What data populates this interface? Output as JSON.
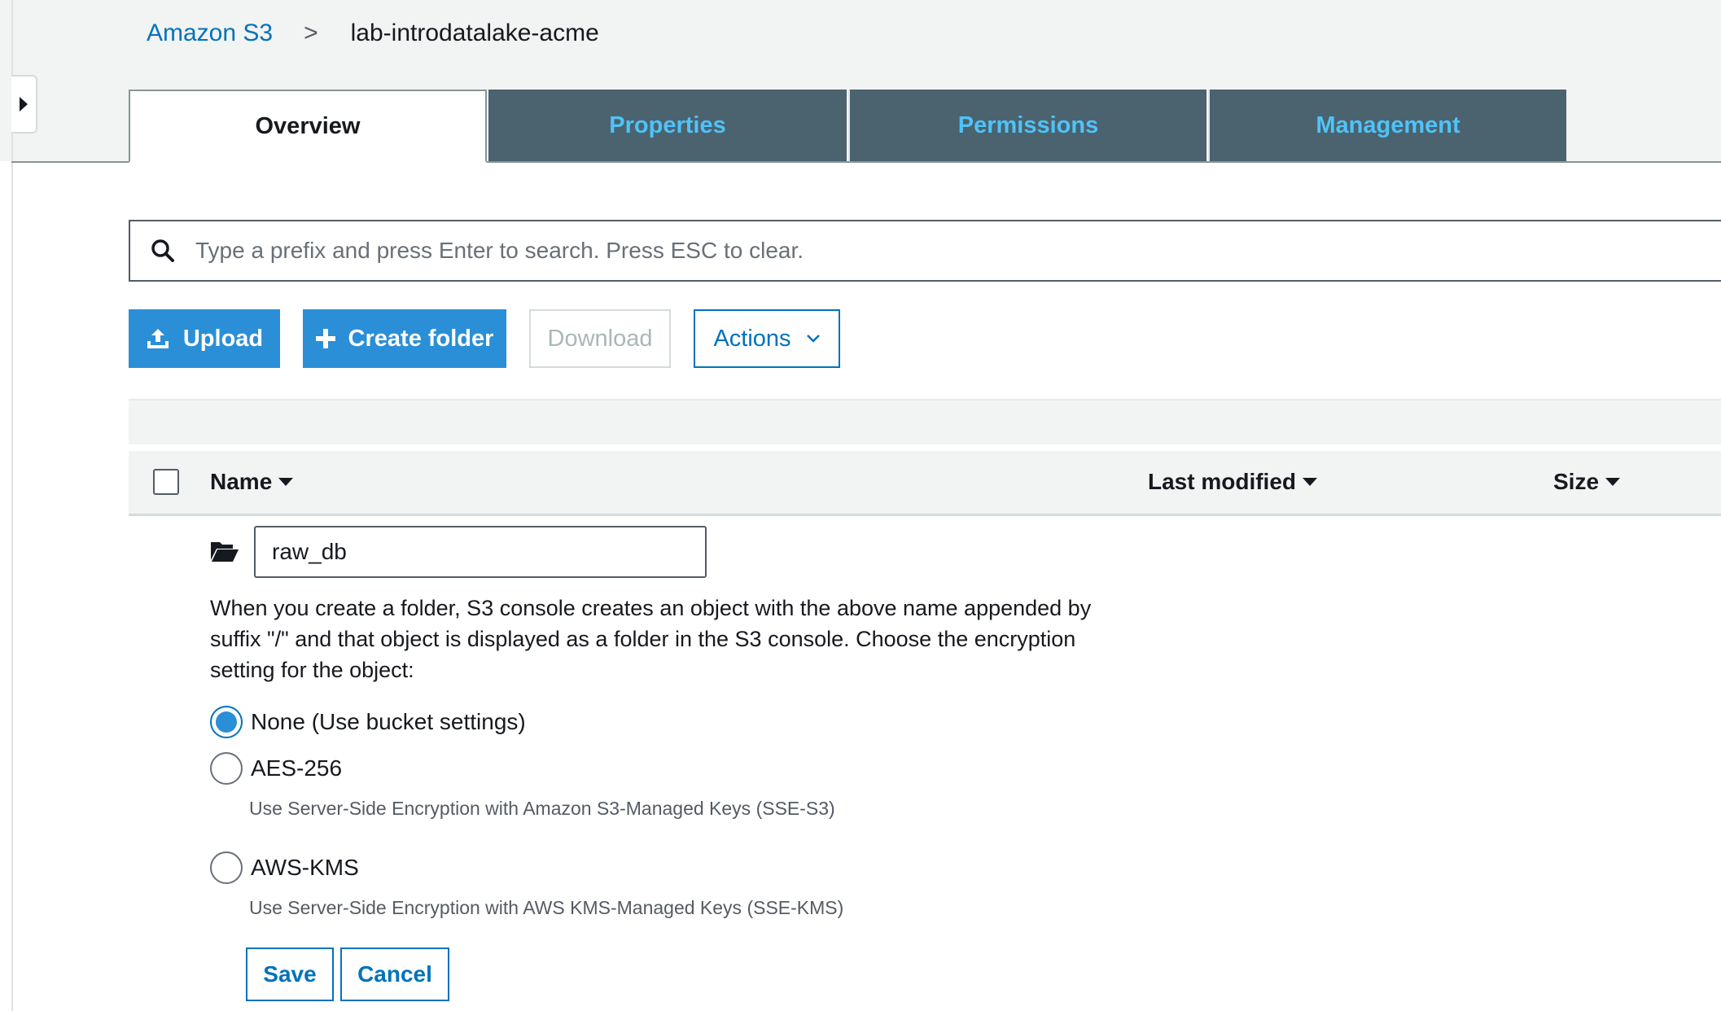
{
  "breadcrumb": {
    "root": "Amazon S3",
    "separator": ">",
    "current": "lab-introdatalake-acme"
  },
  "tabs": [
    {
      "label": "Overview",
      "active": true
    },
    {
      "label": "Properties",
      "active": false
    },
    {
      "label": "Permissions",
      "active": false
    },
    {
      "label": "Management",
      "active": false
    }
  ],
  "search": {
    "icon": "search-icon",
    "placeholder": "Type a prefix and press Enter to search. Press ESC to clear.",
    "value": ""
  },
  "toolbar": {
    "upload": {
      "label": "Upload",
      "icon": "upload-icon"
    },
    "create_folder": {
      "label": "Create folder",
      "icon": "plus-icon"
    },
    "download": {
      "label": "Download",
      "disabled": true
    },
    "actions": {
      "label": "Actions",
      "icon": "chevron-down-icon"
    }
  },
  "table": {
    "columns": [
      {
        "label": "Name",
        "sort_icon": "caret-down-icon"
      },
      {
        "label": "Last modified",
        "sort_icon": "caret-down-icon"
      },
      {
        "label": "Size",
        "sort_icon": "caret-down-icon"
      }
    ],
    "select_all_checked": false
  },
  "new_folder": {
    "icon": "folder-open-icon",
    "name_value": "raw_db",
    "description": "When you create a folder, S3 console creates an object with the above name appended by suffix \"/\" and that object is displayed as a folder in the S3 console. Choose the encryption setting for the object:",
    "encryption_options": [
      {
        "label": "None (Use bucket settings)",
        "hint": "",
        "selected": true
      },
      {
        "label": "AES-256",
        "hint": "Use Server-Side Encryption with Amazon S3-Managed Keys (SSE-S3)",
        "selected": false
      },
      {
        "label": "AWS-KMS",
        "hint": "Use Server-Side Encryption with AWS KMS-Managed Keys (SSE-KMS)",
        "selected": false
      }
    ],
    "save_label": "Save",
    "cancel_label": "Cancel"
  },
  "colors": {
    "link": "#0073bb",
    "primary_button": "#2a8fd6",
    "tab_inactive_bg": "#4b626f",
    "tab_inactive_text": "#4fc3f7"
  }
}
